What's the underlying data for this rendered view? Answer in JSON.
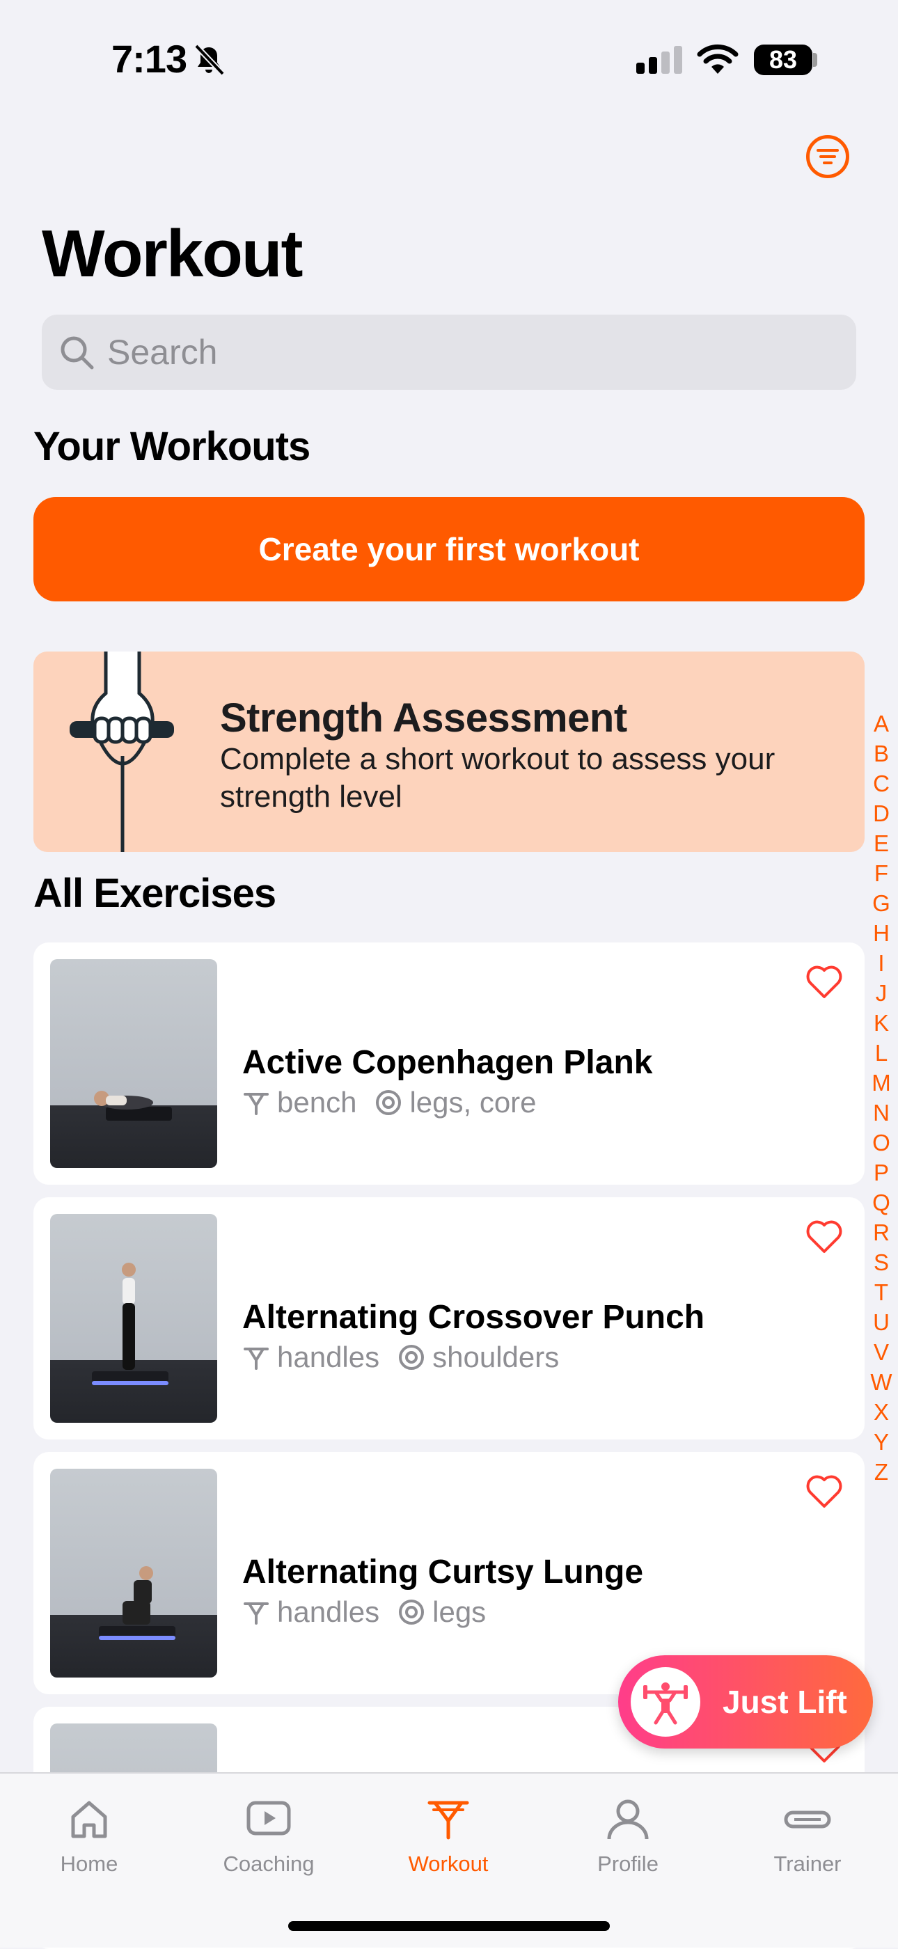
{
  "status_bar": {
    "time": "7:13",
    "battery": "83"
  },
  "header": {
    "title": "Workout"
  },
  "search": {
    "placeholder": "Search"
  },
  "your_workouts": {
    "title": "Your Workouts",
    "create_button": "Create your first workout"
  },
  "assessment": {
    "title": "Strength Assessment",
    "description": "Complete a short workout to assess your strength level"
  },
  "all_exercises": {
    "title": "All Exercises",
    "items": [
      {
        "name": "Active Copenhagen Plank",
        "equipment": "bench",
        "muscles": "legs, core"
      },
      {
        "name": "Alternating Crossover Punch",
        "equipment": "handles",
        "muscles": "shoulders"
      },
      {
        "name": "Alternating Curtsy Lunge",
        "equipment": "handles",
        "muscles": "legs"
      }
    ]
  },
  "alphabet_index": [
    "A",
    "B",
    "C",
    "D",
    "E",
    "F",
    "G",
    "H",
    "I",
    "J",
    "K",
    "L",
    "M",
    "N",
    "O",
    "P",
    "Q",
    "R",
    "S",
    "T",
    "U",
    "V",
    "W",
    "X",
    "Y",
    "Z"
  ],
  "just_lift": {
    "label": "Just Lift"
  },
  "tabs": [
    {
      "label": "Home",
      "icon": "home-icon"
    },
    {
      "label": "Coaching",
      "icon": "play-icon"
    },
    {
      "label": "Workout",
      "icon": "workout-icon",
      "active": true
    },
    {
      "label": "Profile",
      "icon": "profile-icon"
    },
    {
      "label": "Trainer",
      "icon": "trainer-icon"
    }
  ],
  "colors": {
    "accent": "#ff5a00",
    "assessment_bg": "#fdd3bc",
    "background": "#f2f2f7"
  }
}
